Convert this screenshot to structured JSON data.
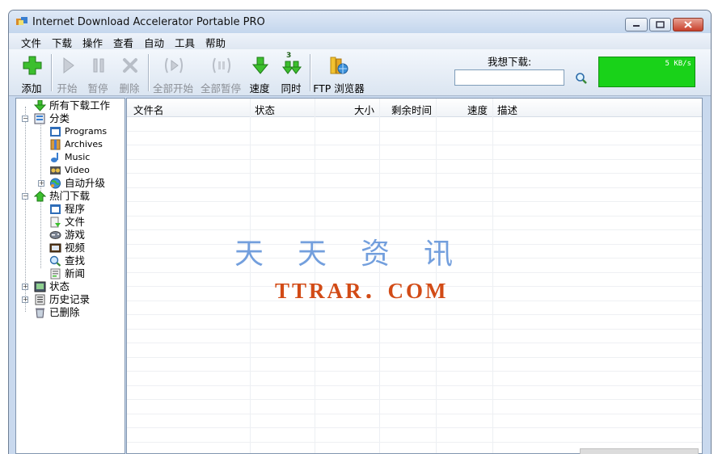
{
  "window": {
    "title": "Internet Download Accelerator Portable PRO"
  },
  "menu": [
    "文件",
    "下载",
    "操作",
    "查看",
    "自动",
    "工具",
    "帮助"
  ],
  "toolbar": {
    "add": "添加",
    "start": "开始",
    "pause": "暂停",
    "delete": "删除",
    "start_all": "全部开始",
    "pause_all": "全部暂停",
    "speed": "速度",
    "simultaneous": "同时",
    "simultaneous_count": "3",
    "ftp": "FTP 浏览器",
    "want_download_label": "我想下载:",
    "want_download_value": "",
    "speed_readout": "5 KB/s",
    "speed_color": "#19d219"
  },
  "tree": {
    "all": "所有下载工作",
    "categories": "分类",
    "programs": "Programs",
    "archives": "Archives",
    "music": "Music",
    "video": "Video",
    "auto_update": "自动升级",
    "hot": "热门下载",
    "hot_programs": "程序",
    "hot_files": "文件",
    "hot_games": "游戏",
    "hot_video": "视频",
    "hot_search": "查找",
    "hot_news": "新闻",
    "status": "状态",
    "history": "历史记录",
    "deleted": "已删除"
  },
  "columns": [
    "文件名",
    "状态",
    "大小",
    "剩余时间",
    "速度",
    "描述"
  ],
  "watermark": {
    "line1": "天天资讯",
    "line2": "TTRAR．COM"
  }
}
